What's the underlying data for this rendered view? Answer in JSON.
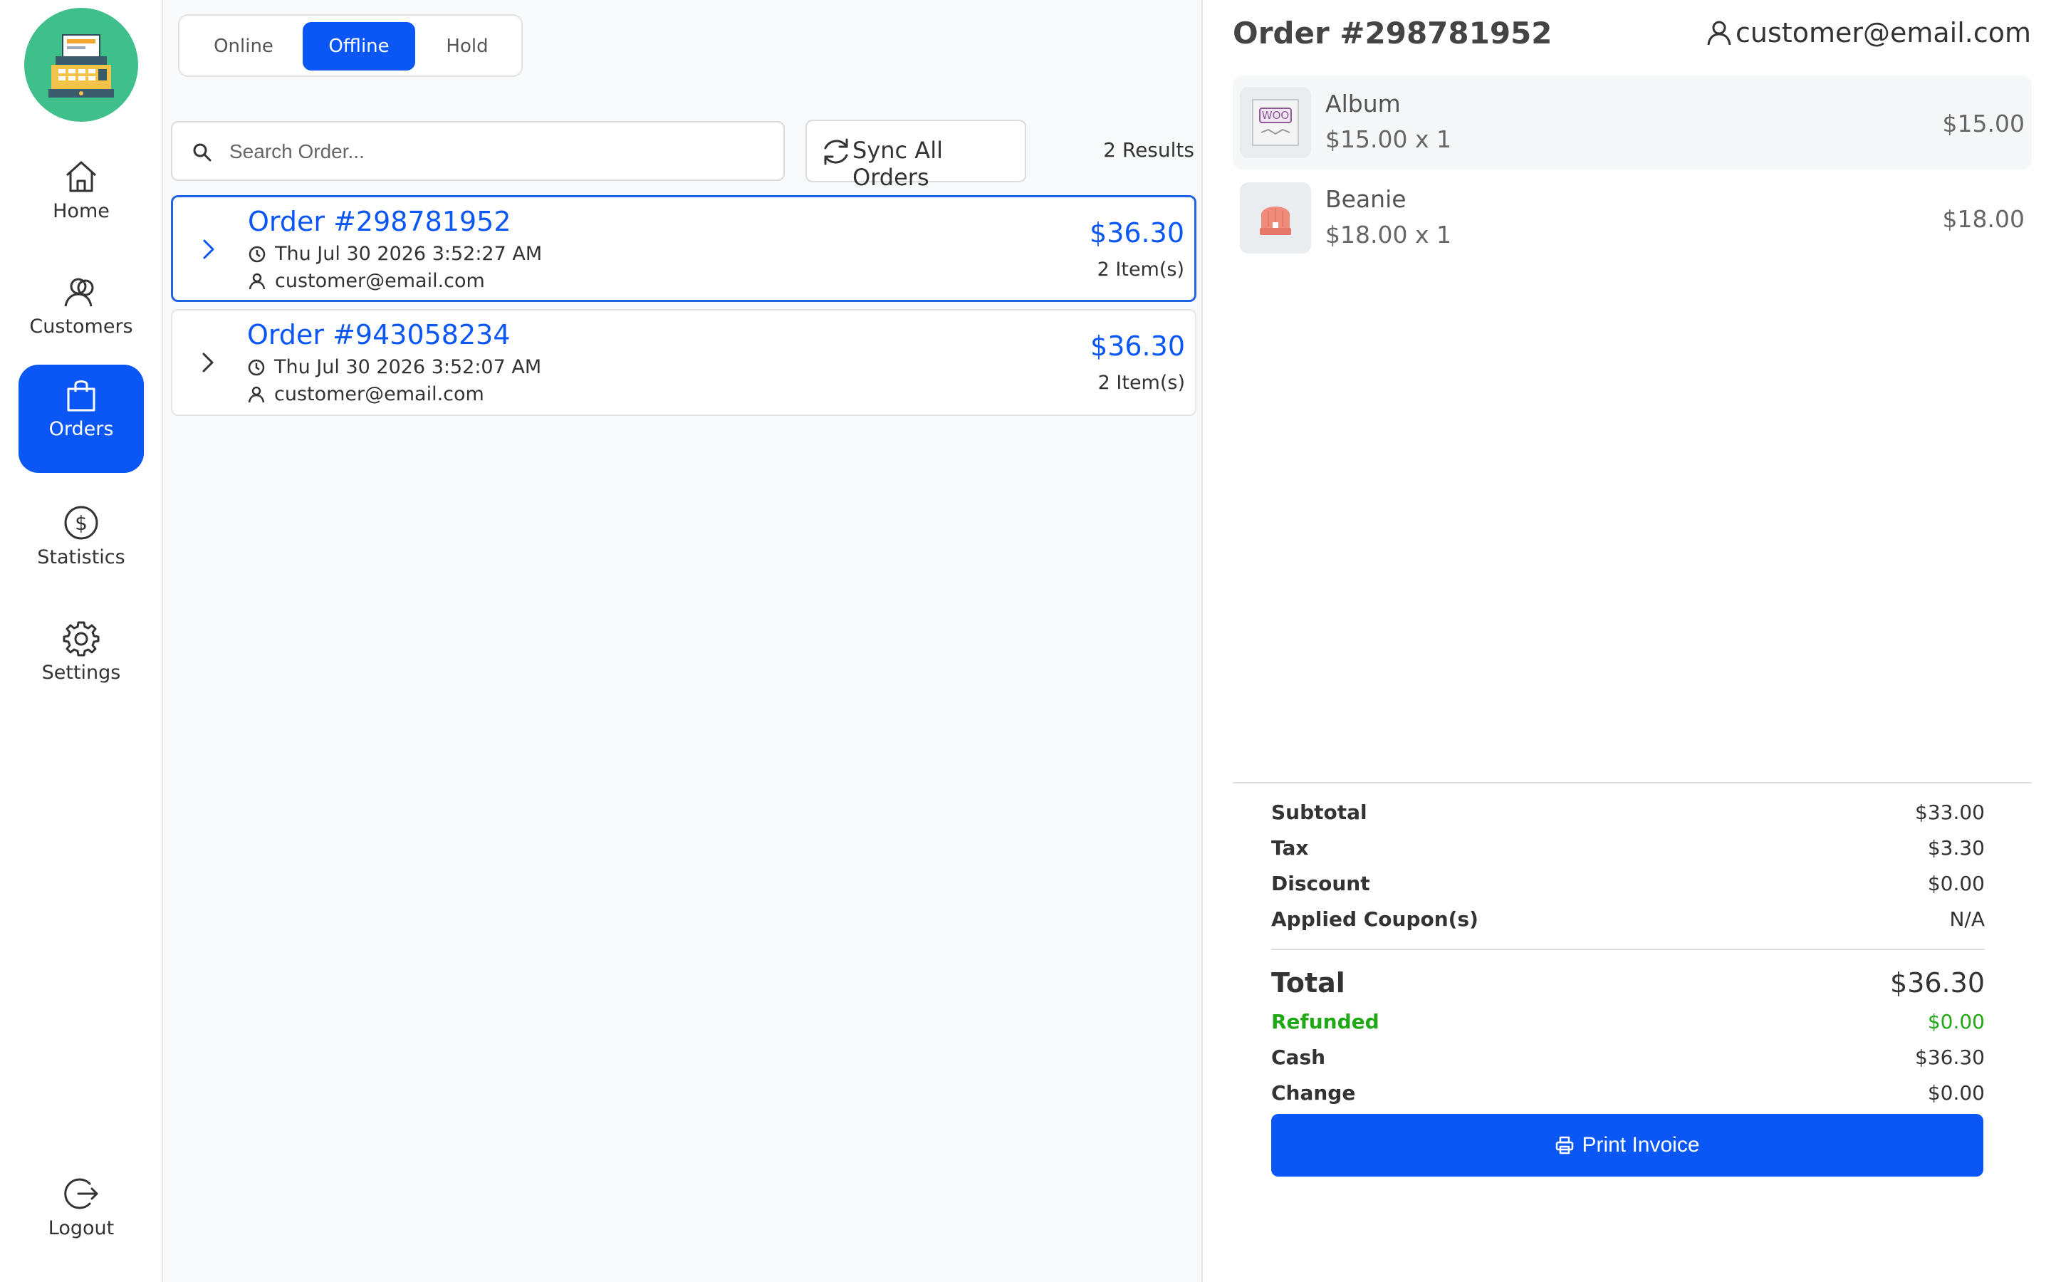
{
  "sidebar": {
    "items": [
      {
        "label": "Home",
        "icon": "home-icon"
      },
      {
        "label": "Customers",
        "icon": "customers-icon"
      },
      {
        "label": "Orders",
        "icon": "shopping-bag-icon",
        "active": true
      },
      {
        "label": "Statistics",
        "icon": "dollar-circle-icon"
      },
      {
        "label": "Settings",
        "icon": "gear-icon"
      }
    ],
    "logout_label": "Logout"
  },
  "tabs": [
    {
      "label": "Online"
    },
    {
      "label": "Offline",
      "active": true
    },
    {
      "label": "Hold"
    }
  ],
  "search": {
    "placeholder": "Search Order...",
    "value": ""
  },
  "sync_label": "Sync All Orders",
  "results_label": "2 Results",
  "orders": [
    {
      "title": "Order #298781952",
      "date": "Thu Jul 30 2026 3:52:27 AM",
      "customer": "customer@email.com",
      "total": "$36.30",
      "items": "2 Item(s)",
      "selected": true
    },
    {
      "title": "Order #943058234",
      "date": "Thu Jul 30 2026 3:52:07 AM",
      "customer": "customer@email.com",
      "total": "$36.30",
      "items": "2 Item(s)"
    }
  ],
  "detail": {
    "title": "Order #298781952",
    "customer": "customer@email.com",
    "line_items": [
      {
        "name": "Album",
        "qty": "$15.00 x 1",
        "price": "$15.00"
      },
      {
        "name": "Beanie",
        "qty": "$18.00 x 1",
        "price": "$18.00"
      }
    ],
    "summary": {
      "subtotal_label": "Subtotal",
      "subtotal": "$33.00",
      "tax_label": "Tax",
      "tax": "$3.30",
      "discount_label": "Discount",
      "discount": "$0.00",
      "coupon_label": "Applied Coupon(s)",
      "coupon": "N/A",
      "total_label": "Total",
      "total": "$36.30",
      "refunded_label": "Refunded",
      "refunded": "$0.00",
      "cash_label": "Cash",
      "cash": "$36.30",
      "change_label": "Change",
      "change": "$0.00"
    },
    "print_label": "Print Invoice"
  },
  "colors": {
    "accent": "#0b57f5",
    "refund_green": "#21a816",
    "logo_green": "#3fbf8a"
  }
}
